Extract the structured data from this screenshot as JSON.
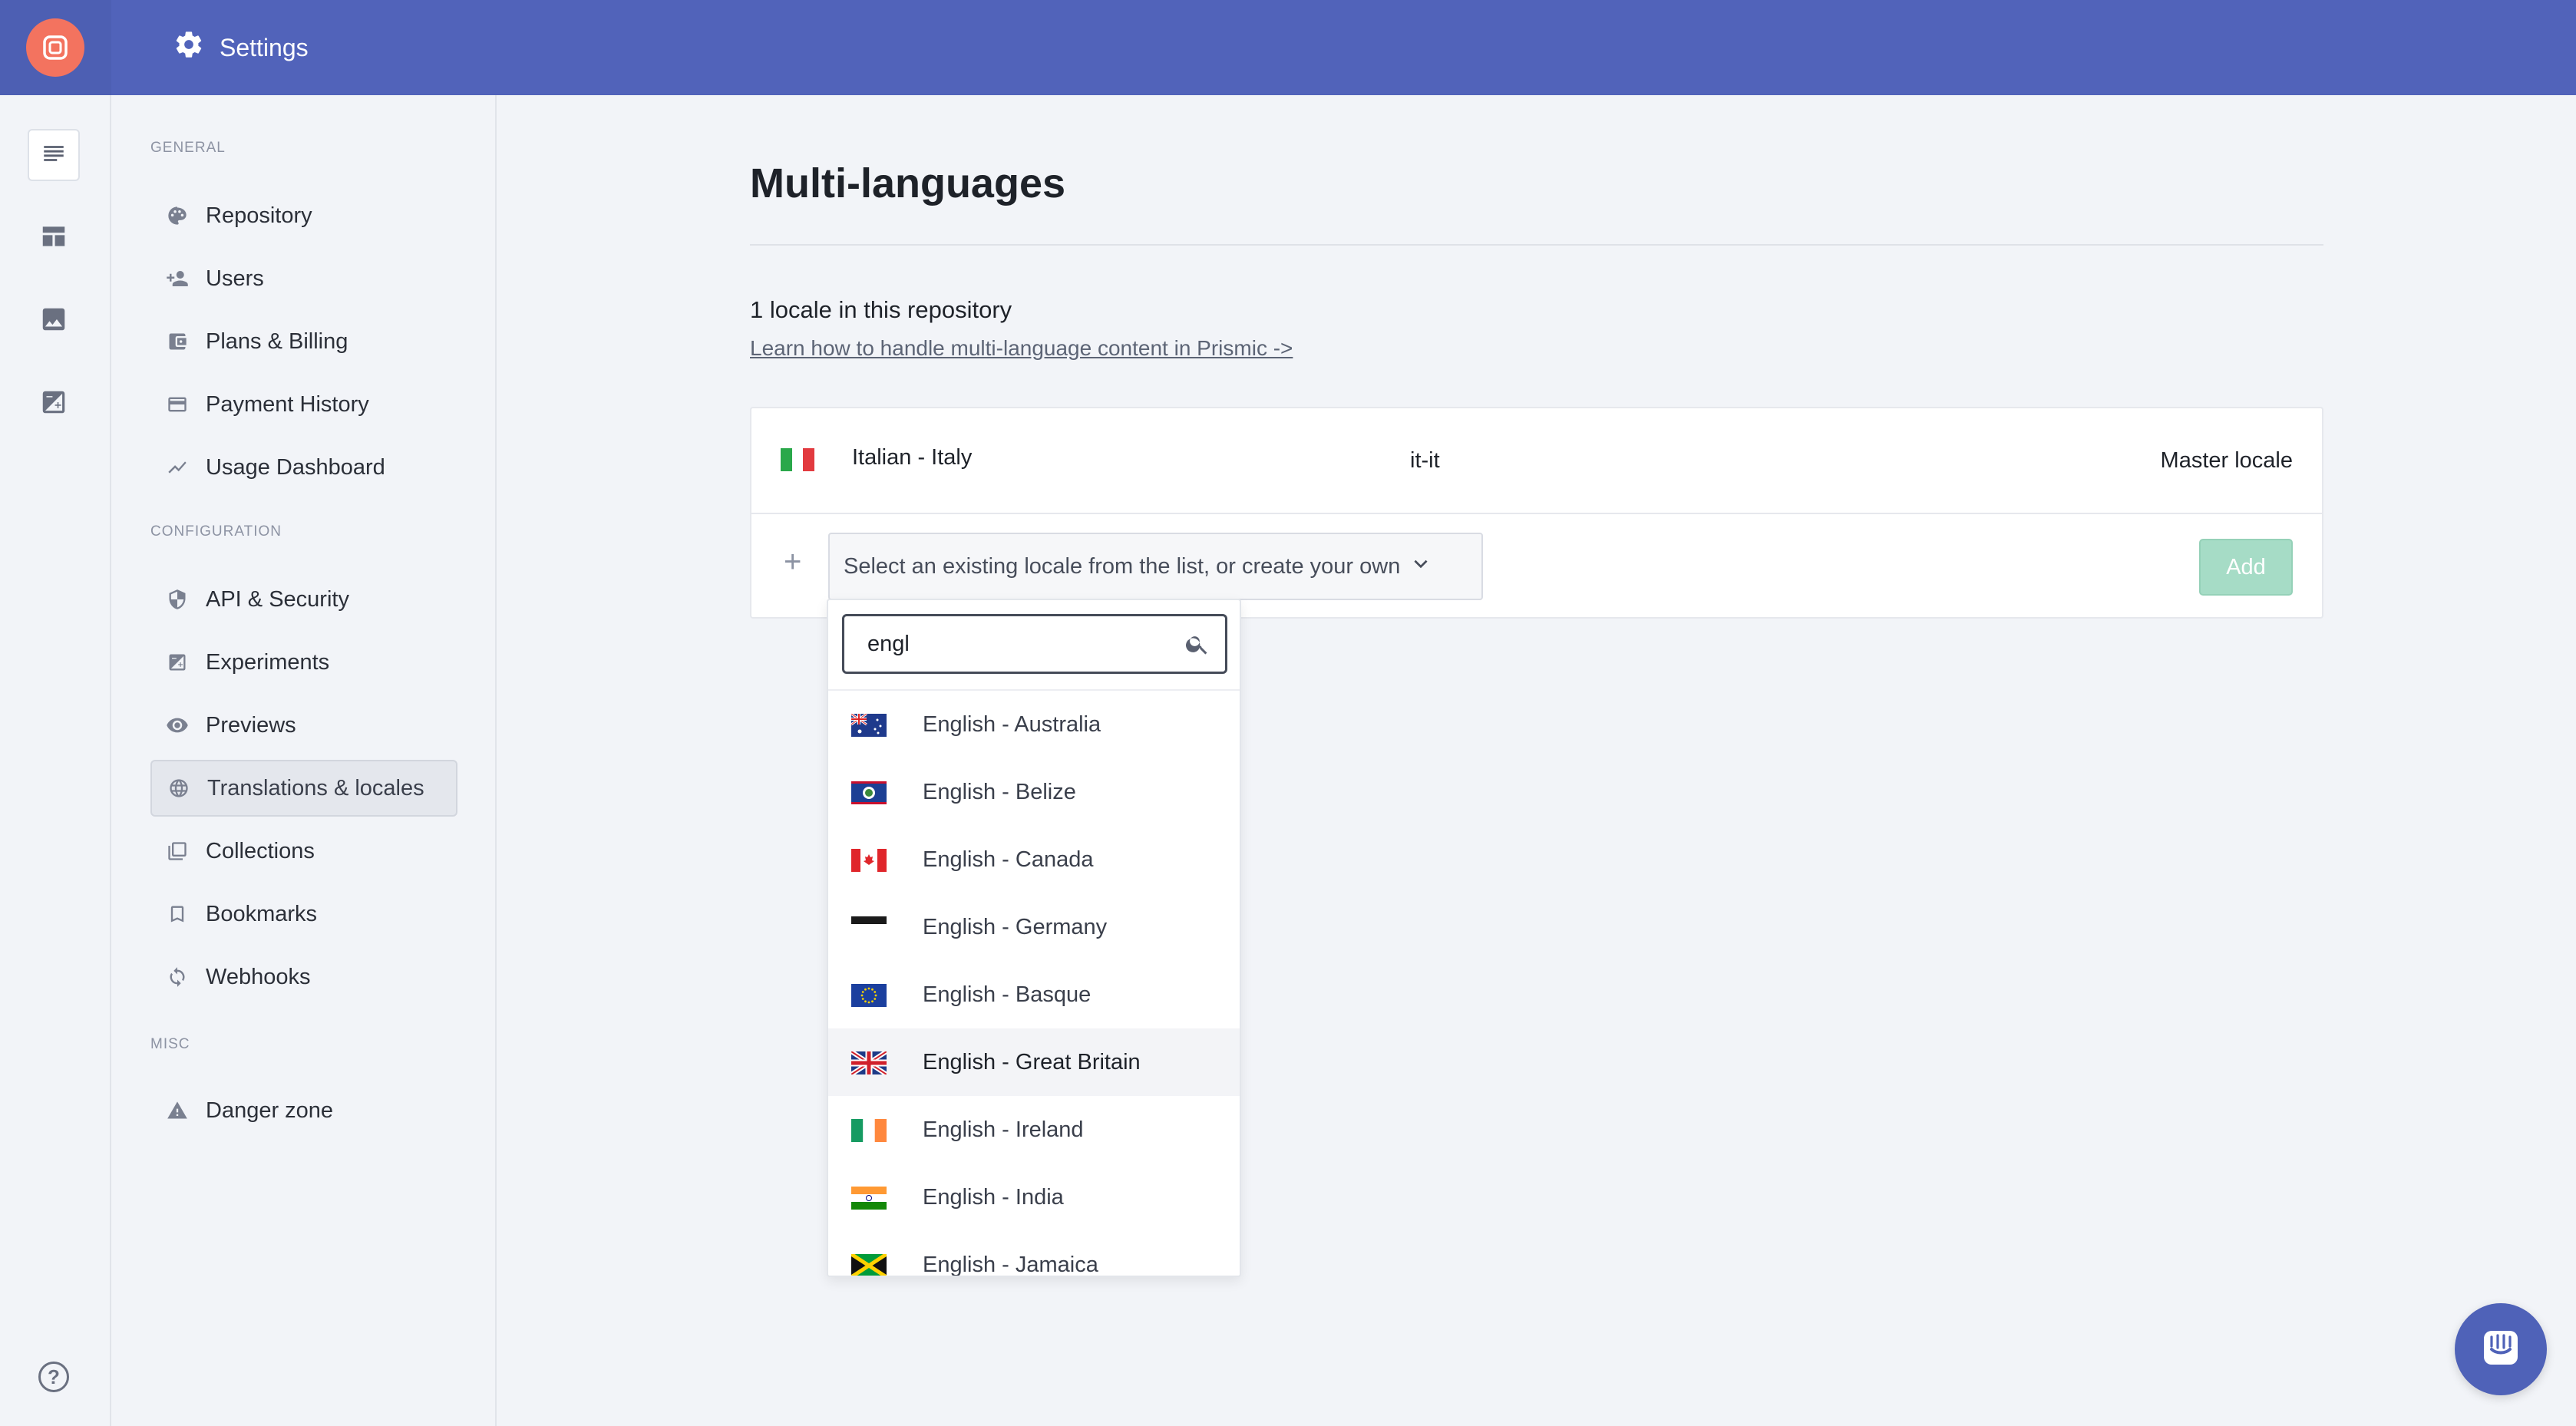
{
  "topbar": {
    "title": "Settings"
  },
  "sidebar": {
    "sections": [
      {
        "label": "General"
      },
      {
        "label": "Configuration"
      },
      {
        "label": "Misc"
      }
    ],
    "items": [
      {
        "label": "Repository",
        "icon": "palette-icon"
      },
      {
        "label": "Users",
        "icon": "add-user-icon"
      },
      {
        "label": "Plans & Billing",
        "icon": "wallet-icon"
      },
      {
        "label": "Payment History",
        "icon": "credit-card-icon"
      },
      {
        "label": "Usage Dashboard",
        "icon": "trend-line-icon"
      },
      {
        "label": "API & Security",
        "icon": "shield-icon"
      },
      {
        "label": "Experiments",
        "icon": "experiment-icon"
      },
      {
        "label": "Previews",
        "icon": "eye-icon"
      },
      {
        "label": "Translations & locales",
        "icon": "globe-icon",
        "active": true
      },
      {
        "label": "Collections",
        "icon": "collections-icon"
      },
      {
        "label": "Bookmarks",
        "icon": "bookmark-icon"
      },
      {
        "label": "Webhooks",
        "icon": "sync-icon"
      },
      {
        "label": "Danger zone",
        "icon": "warning-icon"
      }
    ]
  },
  "main": {
    "title": "Multi-languages",
    "locale_count": "1 locale in this repository",
    "learn_link": "Learn how to handle multi-language content in Prismic ->",
    "locales": [
      {
        "name": "Italian - Italy",
        "code": "it-it",
        "status": "Master locale",
        "flag": "italy-flag-icon"
      }
    ],
    "select_placeholder": "Select an existing locale from the list, or create your own",
    "add_label": "Add",
    "dropdown": {
      "search_value": "engl",
      "options": [
        {
          "label": "English - Australia",
          "flag": "australia-flag-icon"
        },
        {
          "label": "English - Belize",
          "flag": "belize-flag-icon"
        },
        {
          "label": "English - Canada",
          "flag": "canada-flag-icon"
        },
        {
          "label": "English - Germany",
          "flag": "germany-flag-icon"
        },
        {
          "label": "English - Basque",
          "flag": "eu-flag-icon"
        },
        {
          "label": "English - Great Britain",
          "flag": "uk-flag-icon",
          "hover": true
        },
        {
          "label": "English - Ireland",
          "flag": "ireland-flag-icon"
        },
        {
          "label": "English - India",
          "flag": "india-flag-icon"
        },
        {
          "label": "English - Jamaica",
          "flag": "jamaica-flag-icon"
        }
      ]
    }
  },
  "colors": {
    "topbar": "#5163ba",
    "logo": "#f3735f",
    "add_button": "#a6dcc6",
    "chat_button": "#4f62b8"
  }
}
